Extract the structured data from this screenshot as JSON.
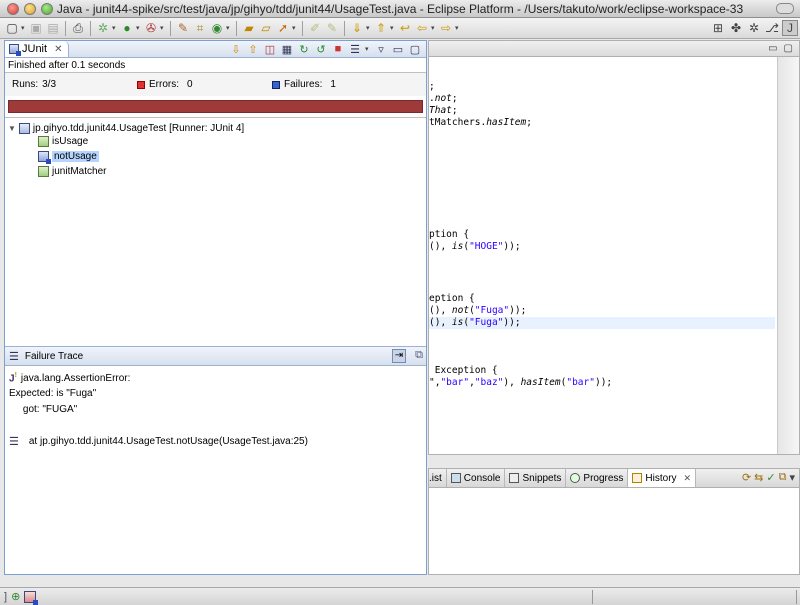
{
  "window": {
    "title": "Java - junit44-spike/src/test/java/jp/gihyo/tdd/junit44/UsageTest.java - Eclipse Platform - /Users/takuto/work/eclipse-workspace-33"
  },
  "junit_view": {
    "tab_label": "JUnit",
    "status": "Finished after 0.1 seconds",
    "runs_label": "Runs:",
    "runs_value": "3/3",
    "errors_label": "Errors:",
    "errors_value": "0",
    "failures_label": "Failures:",
    "failures_value": "1",
    "progress_color": "#9e3a3a",
    "suite_label": "jp.gihyo.tdd.junit44.UsageTest [Runner: JUnit 4]",
    "tests": [
      {
        "name": "isUsage",
        "status": "passed"
      },
      {
        "name": "notUsage",
        "status": "failed",
        "selected": true
      },
      {
        "name": "junitMatcher",
        "status": "passed"
      }
    ]
  },
  "failure_trace": {
    "title": "Failure Trace",
    "lines": [
      "java.lang.AssertionError:",
      "Expected: is \"Fuga\"",
      "     got: \"FUGA\"",
      "at jp.gihyo.tdd.junit44.UsageTest.notUsage(UsageTest.java:25)"
    ]
  },
  "editor": {
    "lines": [
      {
        "parts": [
          {
            "t": ";",
            "c": ""
          }
        ]
      },
      {
        "parts": [
          {
            "t": ".",
            "c": ""
          },
          {
            "t": "not",
            "c": "it"
          },
          {
            "t": ";",
            "c": ""
          }
        ]
      },
      {
        "parts": [
          {
            "t": "That",
            "c": "it"
          },
          {
            "t": ";",
            "c": ""
          }
        ]
      },
      {
        "parts": [
          {
            "t": "tMatchers.",
            "c": ""
          },
          {
            "t": "hasItem",
            "c": "it"
          },
          {
            "t": ";",
            "c": ""
          }
        ]
      },
      {
        "parts": [
          {
            "t": "ption {",
            "c": ""
          }
        ]
      },
      {
        "parts": [
          {
            "t": "(), ",
            "c": ""
          },
          {
            "t": "is",
            "c": "it"
          },
          {
            "t": "(",
            "c": ""
          },
          {
            "t": "\"HOGE\"",
            "c": "str"
          },
          {
            "t": "));",
            "c": ""
          }
        ]
      },
      {
        "parts": [
          {
            "t": "eption {",
            "c": ""
          }
        ]
      },
      {
        "parts": [
          {
            "t": "(), ",
            "c": ""
          },
          {
            "t": "not",
            "c": "it"
          },
          {
            "t": "(",
            "c": ""
          },
          {
            "t": "\"Fuga\"",
            "c": "str"
          },
          {
            "t": "));",
            "c": ""
          }
        ]
      },
      {
        "parts": [
          {
            "t": "(), ",
            "c": ""
          },
          {
            "t": "is",
            "c": "it"
          },
          {
            "t": "(",
            "c": ""
          },
          {
            "t": "\"Fuga\"",
            "c": "str"
          },
          {
            "t": "));",
            "c": ""
          }
        ],
        "highlight": true
      },
      {
        "parts": [
          {
            "t": " Exception {",
            "c": ""
          }
        ]
      },
      {
        "parts": [
          {
            "t": "\",",
            "c": ""
          },
          {
            "t": "\"bar\"",
            "c": "str"
          },
          {
            "t": ",",
            "c": ""
          },
          {
            "t": "\"baz\"",
            "c": "str"
          },
          {
            "t": "), ",
            "c": ""
          },
          {
            "t": "hasItem",
            "c": "it"
          },
          {
            "t": "(",
            "c": ""
          },
          {
            "t": "\"bar\"",
            "c": "str"
          },
          {
            "t": "));",
            "c": ""
          }
        ]
      }
    ]
  },
  "bottom_tabs": [
    {
      "label": "List",
      "display": ".ist",
      "icon": "list-icon"
    },
    {
      "label": "Console",
      "display": "Console",
      "icon": "console-icon"
    },
    {
      "label": "Snippets",
      "display": "Snippets",
      "icon": "snippets-icon"
    },
    {
      "label": "Progress",
      "display": "Progress",
      "icon": "progress-icon"
    },
    {
      "label": "History",
      "display": "History",
      "icon": "history-icon",
      "active": true
    }
  ]
}
